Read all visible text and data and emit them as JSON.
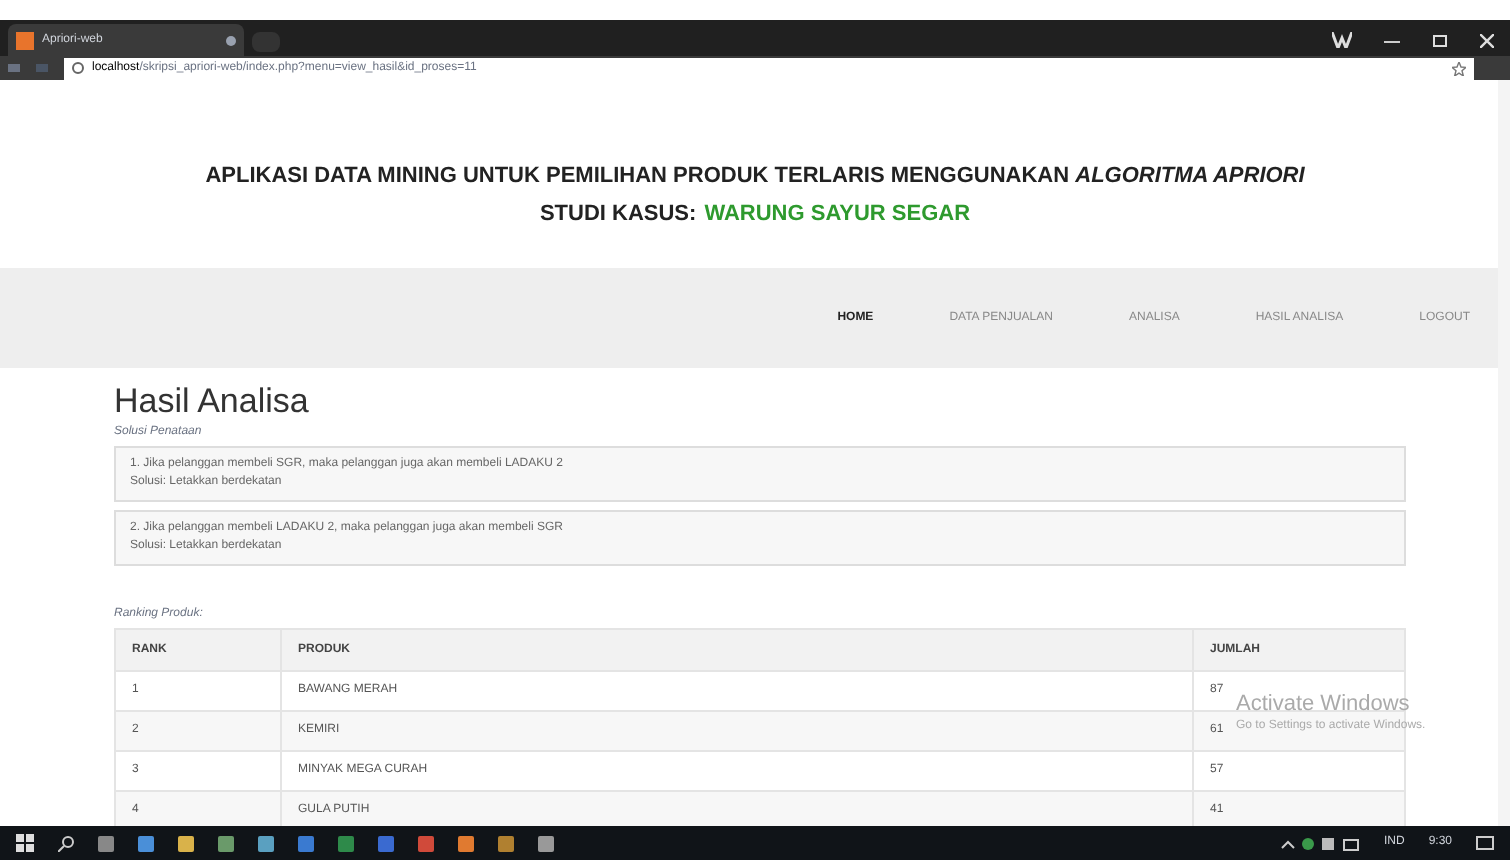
{
  "browser": {
    "tab_title": "Apriori-web",
    "url_host": "localhost",
    "url_path": "/skripsi_apriori-web/index.php?menu=view_hasil&id_proses=11"
  },
  "header": {
    "title": "APLIKASI **DATA MINING** UNTUK PEMILIHAN PRODUK TERLARIS MENGGUNAKAN *ALGORITMA APRIORI*",
    "subtitle_label": "STUDI KASUS:",
    "subtitle_value": "WARUNG SAYUR SEGAR"
  },
  "nav": [
    {
      "label": "HOME",
      "selected": true
    },
    {
      "label": "DATA PENJUALAN",
      "selected": false
    },
    {
      "label": "ANALISA",
      "selected": false
    },
    {
      "label": "HASIL ANALISA",
      "selected": false
    },
    {
      "label": "LOGOUT",
      "selected": false
    }
  ],
  "page_title": "Hasil Analisa",
  "solutions_label": "Solusi Penataan",
  "solutions": [
    {
      "rule": "1. Jika pelanggan membeli SGR, maka pelanggan juga akan membeli LADAKU 2",
      "solution": "Solusi: Letakkan berdekatan"
    },
    {
      "rule": "2. Jika pelanggan membeli LADAKU 2, maka pelanggan juga akan membeli SGR",
      "solution": "Solusi: Letakkan berdekatan"
    }
  ],
  "ranking_label": "Ranking Produk:",
  "table": {
    "columns": [
      "RANK",
      "PRODUK",
      "JUMLAH"
    ],
    "rows": [
      [
        "1",
        "BAWANG MERAH",
        "87"
      ],
      [
        "2",
        "KEMIRI",
        "61"
      ],
      [
        "3",
        "MINYAK MEGA CURAH",
        "57"
      ],
      [
        "4",
        "GULA PUTIH",
        "41"
      ]
    ]
  },
  "activation": {
    "title": "Activate Windows",
    "text": "Go to Settings to activate Windows."
  },
  "taskbar": {
    "language": "IND",
    "time": "9:30"
  }
}
